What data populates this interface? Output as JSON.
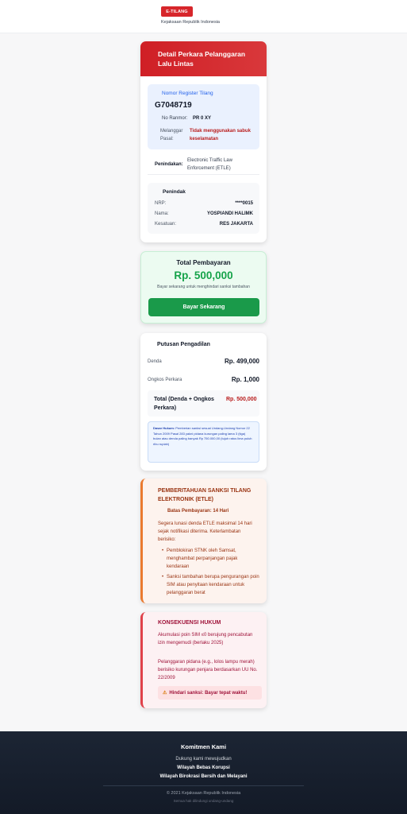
{
  "header": {
    "badge": "E-TILANG",
    "subtitle": "Kejaksaan Republik Indonesia"
  },
  "detail": {
    "title": "Detail Perkara Pelanggaran Lalu Lintas",
    "register_label": "Nomor Register Tilang",
    "register_value": "G7048719",
    "ranmor_label": "No Ranmor:",
    "ranmor_value": "PR 0 XY",
    "pasal_label": "Melanggar Pasal:",
    "pasal_value": "Tidak menggunakan sabuk keselamatan",
    "penindakan_label": "Penindakan:",
    "penindakan_value": "Electronic Traffic Law Enforcement (ETLE)",
    "penindak": {
      "title": "Penindak",
      "nrp_label": "NRP:",
      "nrp_value": "****0015",
      "nama_label": "Nama:",
      "nama_value": "YOSPIANDI HALIMK",
      "kesatuan_label": "Kesatuan:",
      "kesatuan_value": "RES JAKARTA"
    }
  },
  "payment": {
    "title": "Total Pembayaran",
    "amount": "Rp. 500,000",
    "note": "Bayar sekarang untuk menghindari sanksi tambahan",
    "button": "Bayar Sekarang"
  },
  "verdict": {
    "title": "Putusan Pengadilan",
    "denda_label": "Denda",
    "denda_value": "Rp. 499,000",
    "ongkos_label": "Ongkos Perkara",
    "ongkos_value": "Rp. 1,000",
    "total_label": "Total (Denda + Ongkos Perkara)",
    "total_value": "Rp. 500,000",
    "law_bold": "Dasar Hukum:",
    "law_text": "Pemberian sanksi sesuai Undang-Undang Nomor 22 Tahun 2009 Pasal 283 yakni pidana kurungan paling lama 3 (tiga) bulan atau denda paling banyak Rp 750.000,00 (tujuh ratus lima puluh ribu rupiah)"
  },
  "notice": {
    "title": "PEMBERITAHUAN SANKSI TILANG ELEKTRONIK (ETLE)",
    "deadline": "Batas Pembayaran: 14 Hari",
    "paragraph": "Segera lunasi denda ETLE maksimal 14 hari sejak notifikasi diterima. Keterlambatan berisiko:",
    "items": [
      "Pemblokiran STNK oleh Samsat, menghambat perpanjangan pajak kendaraan",
      "Sanksi tambahan berupa pengurangan poin SIM atau penyitaan kendaraan untuk pelanggaran berat"
    ]
  },
  "consequence": {
    "title": "KONSEKUENSI HUKUM",
    "p1": "Akumulasi poin SIM ≤0 berujung pencabutan izin mengemudi (berlaku 2025)",
    "p2": "Pelanggaran pidana (e.g., lolos lampu merah) berisiko kurungan penjara berdasarkan UU No. 22/2009",
    "warning": "Hindari sanksi: Bayar tepat waktu!"
  },
  "footer": {
    "title": "Komitmen Kami",
    "line1": "Dukung kami mewujudkan",
    "line2": "Wilayah Bebas Korupsi",
    "line3": "Wilayah Birokrasi Bersih dan Melayani",
    "copyright": "© 2021 Kejaksaan Republik Indonesia",
    "rights": "Semua hak dilindungi undang-undang"
  },
  "colors": {
    "brand_red": "#d7262b",
    "pay_green": "#1a9a4a",
    "amount_green": "#16a34a",
    "notice_orange": "#ea7a2f",
    "consequence_red": "#e0414a",
    "footer_bg": "#1c2534"
  },
  "icons": {
    "warning": "warning-icon"
  }
}
